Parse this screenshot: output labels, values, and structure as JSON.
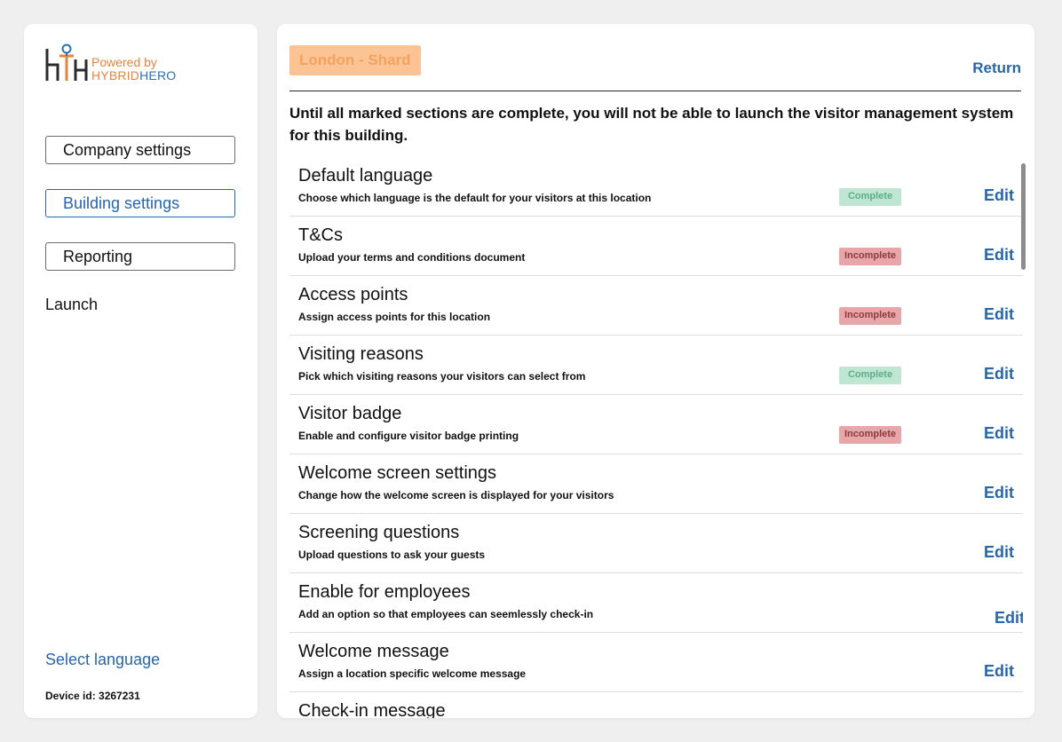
{
  "sidebar": {
    "logo": {
      "powered_by": "Powered by",
      "brand_hybrid": "HYBRID",
      "brand_hero": "HERO"
    },
    "nav": {
      "company_settings": "Company settings",
      "building_settings": "Building settings",
      "reporting": "Reporting",
      "launch": "Launch"
    },
    "select_language": "Select language",
    "device_id": "Device id: 3267231"
  },
  "main": {
    "location": "London - Shard",
    "return_label": "Return",
    "notice": "Until all marked sections are complete, you will not be able to launch the visitor management system for this building.",
    "edit_label": "Edit",
    "sections": [
      {
        "title": "Default language",
        "description": "Choose which language is the default for your visitors at this location",
        "status": "Complete"
      },
      {
        "title": "T&Cs",
        "description": "Upload your terms and conditions document",
        "status": "Incomplete"
      },
      {
        "title": "Access points",
        "description": "Assign access points for this location",
        "status": "Incomplete"
      },
      {
        "title": "Visiting reasons",
        "description": "Pick which visiting reasons your visitors can select from",
        "status": "Complete"
      },
      {
        "title": "Visitor badge",
        "description": "Enable and configure visitor badge printing",
        "status": "Incomplete"
      },
      {
        "title": "Welcome screen settings",
        "description": "Change how the welcome screen is displayed for your visitors",
        "status": ""
      },
      {
        "title": "Screening questions",
        "description": "Upload questions to ask your guests",
        "status": ""
      },
      {
        "title": "Enable for employees",
        "description": "Add an option so that employees can seemlessly check-in",
        "status": ""
      },
      {
        "title": "Welcome message",
        "description": "Assign a location specific welcome message",
        "status": ""
      },
      {
        "title": "Check-in message",
        "description": "",
        "status": ""
      }
    ]
  },
  "colors": {
    "accent_blue": "#2766a8",
    "brand_orange": "#e8833a",
    "complete_bg": "#bfe6d3",
    "incomplete_bg": "#e9a6a8",
    "location_badge_bg": "#fcc494"
  }
}
